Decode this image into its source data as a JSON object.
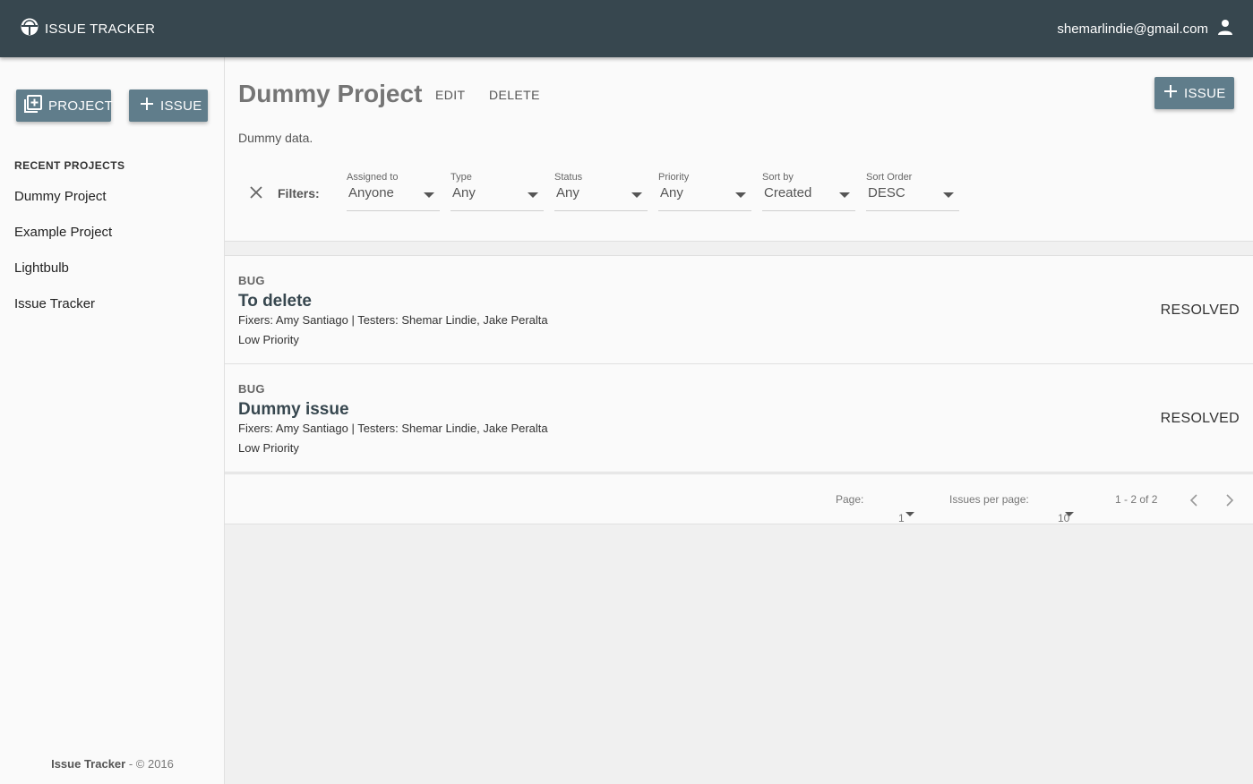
{
  "appbar": {
    "title": "ISSUE TRACKER",
    "user_email": "shemarlindie@gmail.com"
  },
  "sidebar": {
    "project_button": "PROJECT",
    "issue_button": "ISSUE",
    "recent_title": "RECENT PROJECTS",
    "projects": [
      "Dummy Project",
      "Example Project",
      "Lightbulb",
      "Issue Tracker"
    ],
    "footer_name": "Issue Tracker",
    "footer_rest": " - © 2016"
  },
  "project": {
    "title": "Dummy Project",
    "edit_label": "EDIT",
    "delete_label": "DELETE",
    "add_issue_label": "ISSUE",
    "description": "Dummy data."
  },
  "filters": {
    "label": "Filters:",
    "items": [
      {
        "label": "Assigned to",
        "value": "Anyone"
      },
      {
        "label": "Type",
        "value": "Any"
      },
      {
        "label": "Status",
        "value": "Any"
      },
      {
        "label": "Priority",
        "value": "Any"
      },
      {
        "label": "Sort by",
        "value": "Created"
      },
      {
        "label": "Sort Order",
        "value": "DESC"
      }
    ]
  },
  "issues": [
    {
      "type": "BUG",
      "title": "To delete",
      "people": "Fixers: Amy Santiago | Testers: Shemar Lindie, Jake Peralta",
      "priority": "Low Priority",
      "status": "RESOLVED"
    },
    {
      "type": "BUG",
      "title": "Dummy issue",
      "people": "Fixers: Amy Santiago | Testers: Shemar Lindie, Jake Peralta",
      "priority": "Low Priority",
      "status": "RESOLVED"
    }
  ],
  "pager": {
    "page_label": "Page:",
    "page_value": "1",
    "per_page_label": "Issues per page:",
    "per_page_value": "10",
    "range": "1 - 2 of 2"
  },
  "colors": {
    "appbar": "#37474f",
    "button": "#607d8b"
  }
}
